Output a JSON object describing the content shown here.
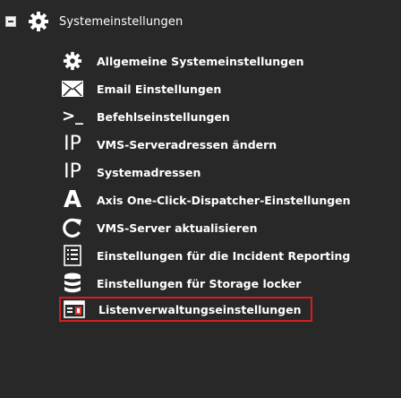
{
  "tree": {
    "root": {
      "label": "Systemeinstellungen",
      "icon": "gear-icon",
      "expanded": true
    },
    "items": [
      {
        "label": "Allgemeine Systemeinstellungen",
        "icon": "gear-icon"
      },
      {
        "label": "Email Einstellungen",
        "icon": "envelope-icon"
      },
      {
        "label": "Befehlseinstellungen",
        "icon": "command-prompt-icon"
      },
      {
        "label": "VMS-Serveradressen ändern",
        "icon": "ip-icon"
      },
      {
        "label": "Systemadressen",
        "icon": "ip-icon"
      },
      {
        "label": "Axis One-Click-Dispatcher-Einstellungen",
        "icon": "axis-a-icon"
      },
      {
        "label": "VMS-Server aktualisieren",
        "icon": "refresh-icon"
      },
      {
        "label": "Einstellungen für die Incident Reporting",
        "icon": "document-list-icon"
      },
      {
        "label": "Einstellungen für Storage locker",
        "icon": "database-icon"
      },
      {
        "label": "Listenverwaltungseinstellungen",
        "icon": "list-management-icon",
        "selected": true
      }
    ],
    "ip_glyph": "IP",
    "prompt_glyph": ">_",
    "axis_glyph": "A"
  },
  "colors": {
    "background": "#282828",
    "text": "#ffffff",
    "selection_border": "#d91d1d",
    "list_icon_accent": "#e23b2f"
  }
}
